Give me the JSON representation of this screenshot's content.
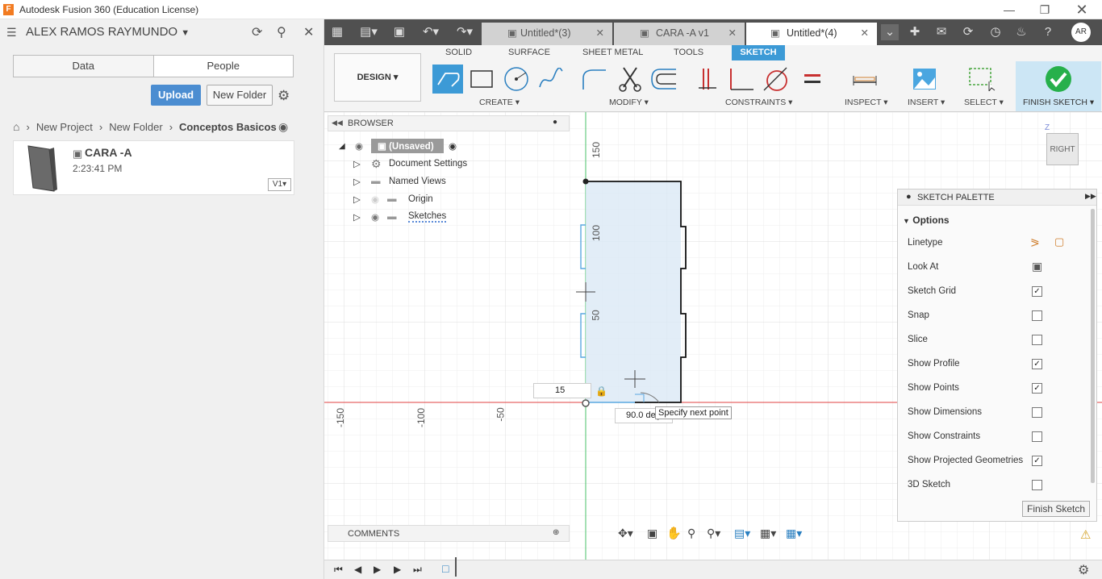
{
  "window": {
    "title": "Autodesk Fusion 360 (Education License)",
    "logo": "F"
  },
  "left_panel": {
    "user": "ALEX RAMOS RAYMUNDO",
    "tabs": [
      "Data",
      "People"
    ],
    "upload_label": "Upload",
    "new_folder_label": "New Folder",
    "breadcrumb": [
      "New Project",
      "New Folder",
      "Conceptos Basicos"
    ],
    "file": {
      "name": "CARA -A",
      "time": "2:23:41 PM",
      "version": "V1"
    }
  },
  "doc_tabs": [
    {
      "label": "Untitled*(3)"
    },
    {
      "label": "CARA -A v1"
    },
    {
      "label": "Untitled*(4)"
    }
  ],
  "avatar": "AR",
  "toolbar": {
    "workspace": "DESIGN",
    "tabs": [
      "SOLID",
      "SURFACE",
      "SHEET METAL",
      "TOOLS",
      "SKETCH"
    ],
    "groups": [
      "CREATE",
      "MODIFY",
      "CONSTRAINTS",
      "INSPECT",
      "INSERT",
      "SELECT"
    ],
    "finish_label": "FINISH SKETCH"
  },
  "browser": {
    "title": "BROWSER",
    "root": "(Unsaved)",
    "items": [
      "Document Settings",
      "Named Views",
      "Origin",
      "Sketches"
    ]
  },
  "canvas": {
    "ruler_v": [
      "150",
      "100",
      "50"
    ],
    "ruler_h": [
      "-150",
      "-100",
      "-50"
    ],
    "length_value": "15",
    "angle_value": "90.0 deg",
    "tooltip": "Specify next point",
    "viewcube": "RIGHT",
    "axis_z": "Z"
  },
  "palette": {
    "title": "SKETCH PALETTE",
    "section": "Options",
    "rows": [
      {
        "label": "Linetype",
        "type": "icons"
      },
      {
        "label": "Look At",
        "type": "icon"
      },
      {
        "label": "Sketch Grid",
        "checked": "✓"
      },
      {
        "label": "Snap",
        "checked": ""
      },
      {
        "label": "Slice",
        "checked": ""
      },
      {
        "label": "Show Profile",
        "checked": "✓"
      },
      {
        "label": "Show Points",
        "checked": "✓"
      },
      {
        "label": "Show Dimensions",
        "checked": ""
      },
      {
        "label": "Show Constraints",
        "checked": ""
      },
      {
        "label": "Show Projected Geometries",
        "checked": "✓"
      },
      {
        "label": "3D Sketch",
        "checked": ""
      }
    ],
    "finish_button": "Finish Sketch"
  },
  "comments": {
    "title": "COMMENTS"
  },
  "colors": {
    "accent": "#3c9ad6",
    "upload": "#4b8dd1",
    "finish_check": "#27b04b",
    "axis_red": "#e04040",
    "axis_green": "#49c26a"
  }
}
